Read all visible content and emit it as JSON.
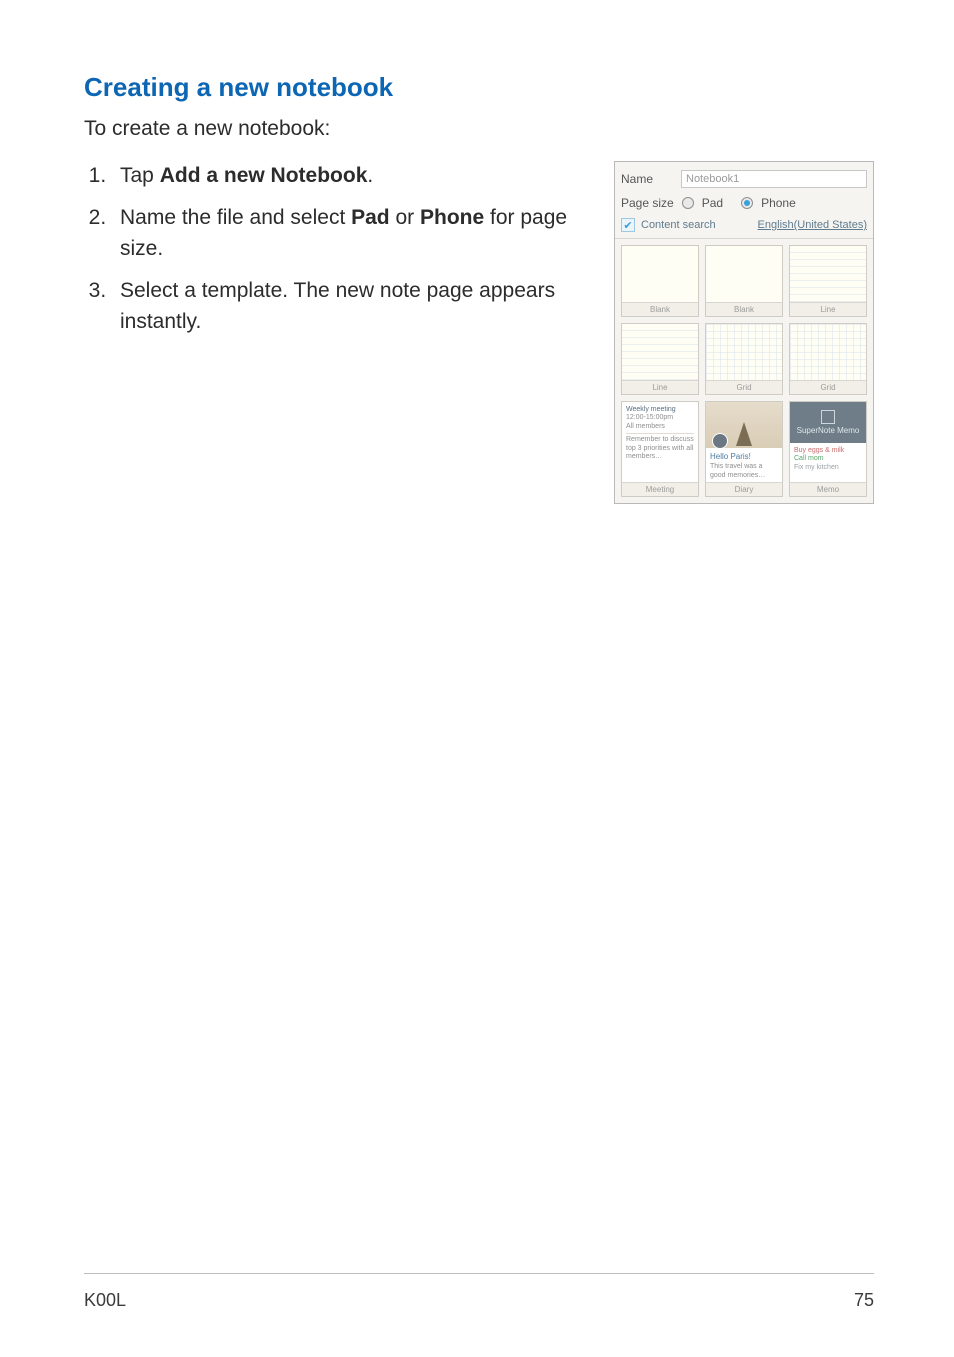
{
  "heading": "Creating a new notebook",
  "intro": "To create a new notebook:",
  "steps": {
    "s1_pre": "Tap ",
    "s1_bold": "Add a new Notebook",
    "s1_post": ".",
    "s2_pre": "Name the file and select ",
    "s2_b1": "Pad",
    "s2_mid": " or ",
    "s2_b2": "Phone",
    "s2_post": " for page size.",
    "s3": "Select a template. The new note page appears instantly."
  },
  "shot": {
    "name_label": "Name",
    "name_value": "Notebook1",
    "pagesize_label": "Page size",
    "opt_pad": "Pad",
    "opt_phone": "Phone",
    "content_search": "Content search",
    "language": "English(United States)",
    "caps": {
      "blank": "Blank",
      "line": "Line",
      "grid": "Grid",
      "meeting": "Meeting",
      "diary": "Diary",
      "memo": "Memo"
    },
    "meeting": {
      "l1": "Weekly meeting",
      "l2": "12:00-15:00pm",
      "l3": "All members",
      "l4": "Remember to discuss top 3 priorities with all members…"
    },
    "diary": {
      "title": "Hello Paris!",
      "text": "This travel was a good memories…"
    },
    "memo": {
      "brand": "SuperNote Memo",
      "i1": "Buy eggs & milk",
      "i2": "Call mom",
      "i3": "Fix my kitchen"
    }
  },
  "footer": {
    "left": "K00L",
    "right": "75"
  }
}
